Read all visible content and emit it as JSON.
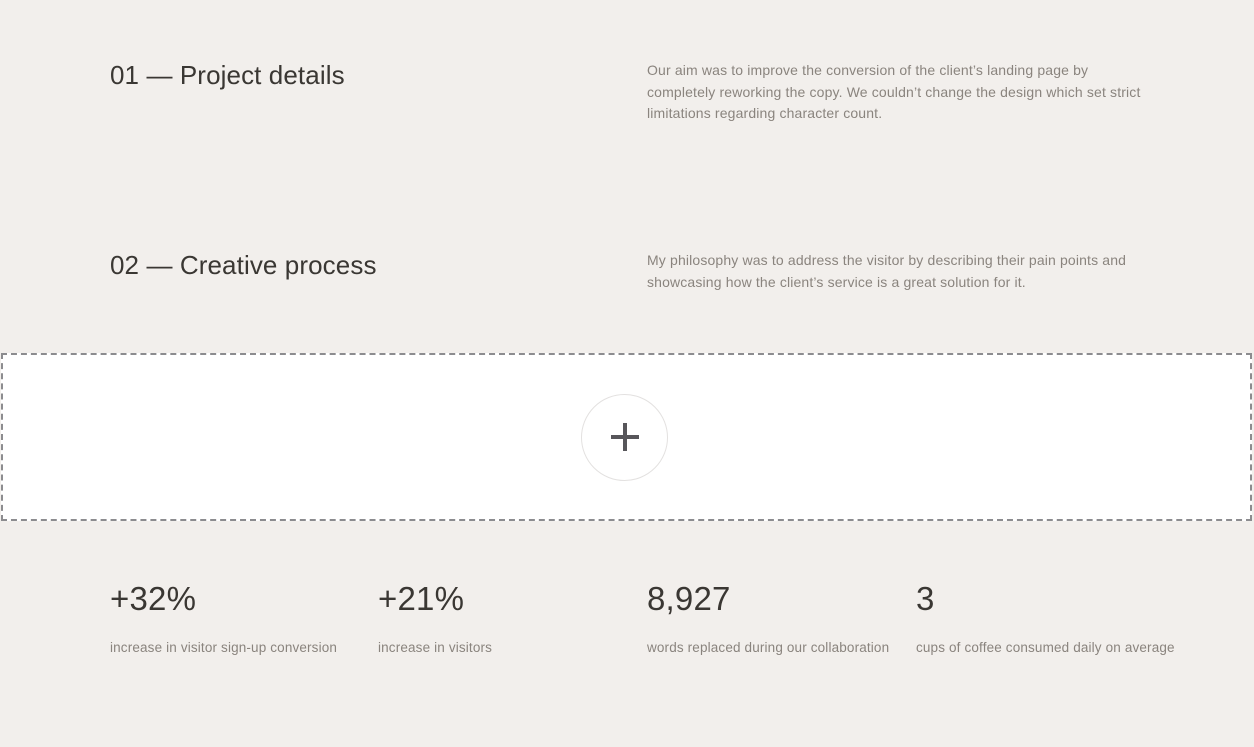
{
  "background_color": "#f2efec",
  "sections": [
    {
      "heading": "01 — Project details",
      "body": "Our aim was to improve the conversion of the client’s landing page by completely reworking the copy. We couldn’t change the design which set strict limitations regarding character count."
    },
    {
      "heading": "02 — Creative process",
      "body": "My philosophy was to address the visitor by describing their pain points and showcasing how the client’s service is a great solution for it."
    }
  ],
  "dropzone": {
    "add_button_icon": "plus-icon",
    "border_color": "#8c8c8f",
    "fill_color": "#ffffff"
  },
  "stats": [
    {
      "value": "+32%",
      "label": "increase in visitor sign-up conversion"
    },
    {
      "value": "+21%",
      "label": "increase in visitors"
    },
    {
      "value": "8,927",
      "label": "words replaced during our collaboration"
    },
    {
      "value": "3",
      "label": "cups of coffee consumed daily on average"
    }
  ]
}
